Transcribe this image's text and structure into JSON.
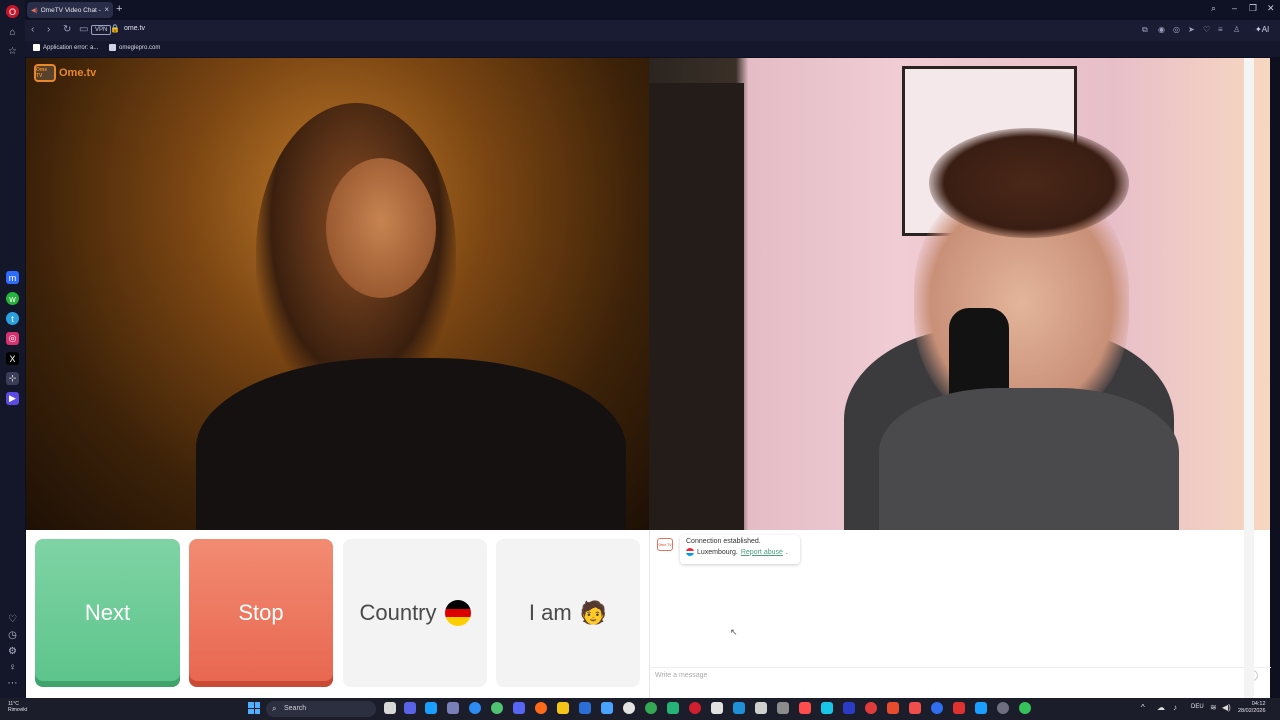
{
  "browser": {
    "tab_title": "OmeTV Video Chat -",
    "url": "ome.tv",
    "vpn_label": "VPN",
    "bookmarks": [
      {
        "label": "Application error: a..."
      },
      {
        "label": "omeglepro.com"
      }
    ]
  },
  "site": {
    "logo_text": "Ome.tv",
    "logo_icon_text": "Ome TV"
  },
  "controls": {
    "next_label": "Next",
    "stop_label": "Stop",
    "country_label": "Country",
    "iam_label": "I am",
    "iam_emoji": "🧑"
  },
  "chat": {
    "status_message": "Connection established.",
    "country": "Luxembourg.",
    "report_link": "Report abuse",
    "input_placeholder": "Write a message"
  },
  "taskbar": {
    "weather_temp": "11°C",
    "weather_desc": "Rimovikt",
    "search_placeholder": "Search",
    "language": "DEU",
    "time": "04:12",
    "date": "28/02/2026"
  },
  "colors": {
    "next": "#5cc48b",
    "stop": "#e8664f",
    "brand": "#e9872a"
  }
}
